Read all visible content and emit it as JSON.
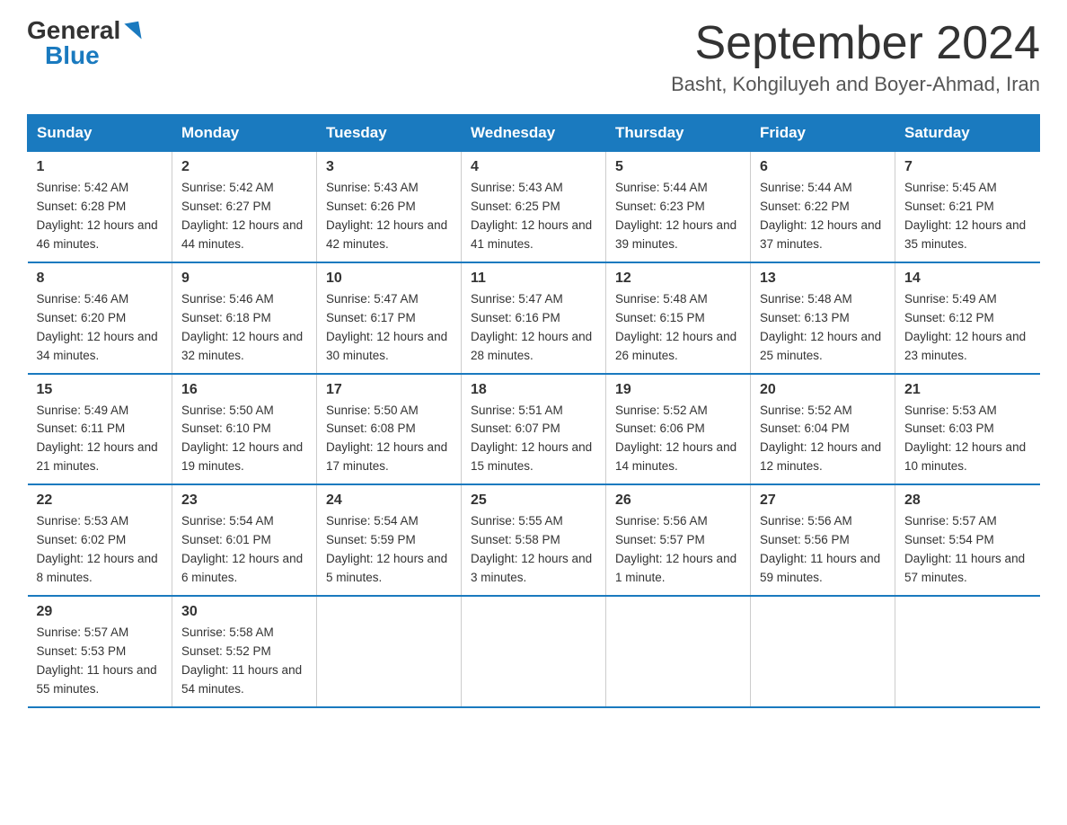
{
  "logo": {
    "general": "General",
    "blue": "Blue",
    "arrow": "▶"
  },
  "title": "September 2024",
  "location": "Basht, Kohgiluyeh and Boyer-Ahmad, Iran",
  "days_of_week": [
    "Sunday",
    "Monday",
    "Tuesday",
    "Wednesday",
    "Thursday",
    "Friday",
    "Saturday"
  ],
  "weeks": [
    [
      {
        "day": "1",
        "sunrise": "5:42 AM",
        "sunset": "6:28 PM",
        "daylight": "12 hours and 46 minutes."
      },
      {
        "day": "2",
        "sunrise": "5:42 AM",
        "sunset": "6:27 PM",
        "daylight": "12 hours and 44 minutes."
      },
      {
        "day": "3",
        "sunrise": "5:43 AM",
        "sunset": "6:26 PM",
        "daylight": "12 hours and 42 minutes."
      },
      {
        "day": "4",
        "sunrise": "5:43 AM",
        "sunset": "6:25 PM",
        "daylight": "12 hours and 41 minutes."
      },
      {
        "day": "5",
        "sunrise": "5:44 AM",
        "sunset": "6:23 PM",
        "daylight": "12 hours and 39 minutes."
      },
      {
        "day": "6",
        "sunrise": "5:44 AM",
        "sunset": "6:22 PM",
        "daylight": "12 hours and 37 minutes."
      },
      {
        "day": "7",
        "sunrise": "5:45 AM",
        "sunset": "6:21 PM",
        "daylight": "12 hours and 35 minutes."
      }
    ],
    [
      {
        "day": "8",
        "sunrise": "5:46 AM",
        "sunset": "6:20 PM",
        "daylight": "12 hours and 34 minutes."
      },
      {
        "day": "9",
        "sunrise": "5:46 AM",
        "sunset": "6:18 PM",
        "daylight": "12 hours and 32 minutes."
      },
      {
        "day": "10",
        "sunrise": "5:47 AM",
        "sunset": "6:17 PM",
        "daylight": "12 hours and 30 minutes."
      },
      {
        "day": "11",
        "sunrise": "5:47 AM",
        "sunset": "6:16 PM",
        "daylight": "12 hours and 28 minutes."
      },
      {
        "day": "12",
        "sunrise": "5:48 AM",
        "sunset": "6:15 PM",
        "daylight": "12 hours and 26 minutes."
      },
      {
        "day": "13",
        "sunrise": "5:48 AM",
        "sunset": "6:13 PM",
        "daylight": "12 hours and 25 minutes."
      },
      {
        "day": "14",
        "sunrise": "5:49 AM",
        "sunset": "6:12 PM",
        "daylight": "12 hours and 23 minutes."
      }
    ],
    [
      {
        "day": "15",
        "sunrise": "5:49 AM",
        "sunset": "6:11 PM",
        "daylight": "12 hours and 21 minutes."
      },
      {
        "day": "16",
        "sunrise": "5:50 AM",
        "sunset": "6:10 PM",
        "daylight": "12 hours and 19 minutes."
      },
      {
        "day": "17",
        "sunrise": "5:50 AM",
        "sunset": "6:08 PM",
        "daylight": "12 hours and 17 minutes."
      },
      {
        "day": "18",
        "sunrise": "5:51 AM",
        "sunset": "6:07 PM",
        "daylight": "12 hours and 15 minutes."
      },
      {
        "day": "19",
        "sunrise": "5:52 AM",
        "sunset": "6:06 PM",
        "daylight": "12 hours and 14 minutes."
      },
      {
        "day": "20",
        "sunrise": "5:52 AM",
        "sunset": "6:04 PM",
        "daylight": "12 hours and 12 minutes."
      },
      {
        "day": "21",
        "sunrise": "5:53 AM",
        "sunset": "6:03 PM",
        "daylight": "12 hours and 10 minutes."
      }
    ],
    [
      {
        "day": "22",
        "sunrise": "5:53 AM",
        "sunset": "6:02 PM",
        "daylight": "12 hours and 8 minutes."
      },
      {
        "day": "23",
        "sunrise": "5:54 AM",
        "sunset": "6:01 PM",
        "daylight": "12 hours and 6 minutes."
      },
      {
        "day": "24",
        "sunrise": "5:54 AM",
        "sunset": "5:59 PM",
        "daylight": "12 hours and 5 minutes."
      },
      {
        "day": "25",
        "sunrise": "5:55 AM",
        "sunset": "5:58 PM",
        "daylight": "12 hours and 3 minutes."
      },
      {
        "day": "26",
        "sunrise": "5:56 AM",
        "sunset": "5:57 PM",
        "daylight": "12 hours and 1 minute."
      },
      {
        "day": "27",
        "sunrise": "5:56 AM",
        "sunset": "5:56 PM",
        "daylight": "11 hours and 59 minutes."
      },
      {
        "day": "28",
        "sunrise": "5:57 AM",
        "sunset": "5:54 PM",
        "daylight": "11 hours and 57 minutes."
      }
    ],
    [
      {
        "day": "29",
        "sunrise": "5:57 AM",
        "sunset": "5:53 PM",
        "daylight": "11 hours and 55 minutes."
      },
      {
        "day": "30",
        "sunrise": "5:58 AM",
        "sunset": "5:52 PM",
        "daylight": "11 hours and 54 minutes."
      },
      {
        "day": "",
        "sunrise": "",
        "sunset": "",
        "daylight": ""
      },
      {
        "day": "",
        "sunrise": "",
        "sunset": "",
        "daylight": ""
      },
      {
        "day": "",
        "sunrise": "",
        "sunset": "",
        "daylight": ""
      },
      {
        "day": "",
        "sunrise": "",
        "sunset": "",
        "daylight": ""
      },
      {
        "day": "",
        "sunrise": "",
        "sunset": "",
        "daylight": ""
      }
    ]
  ]
}
